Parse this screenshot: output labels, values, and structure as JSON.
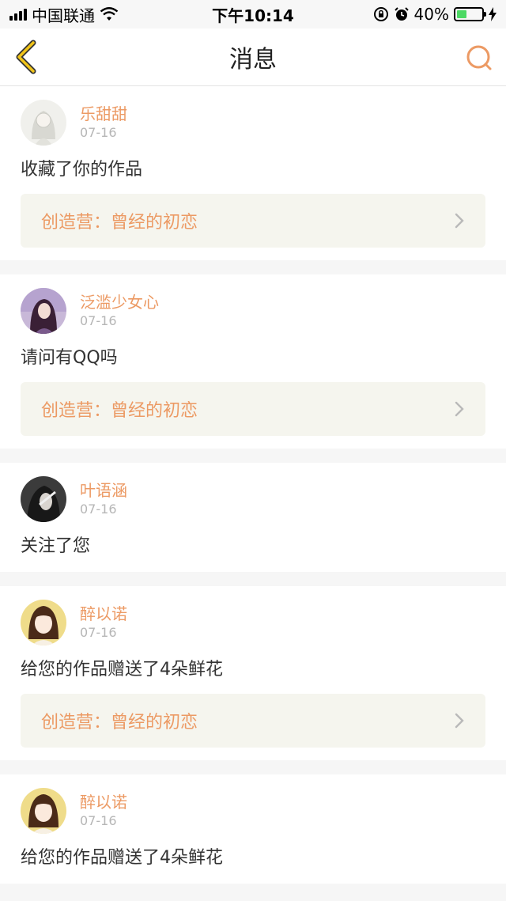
{
  "status": {
    "carrier": "中国联通",
    "time": "下午10:14",
    "battery": "40%",
    "battery_level": 0.4
  },
  "header": {
    "title": "消息"
  },
  "colors": {
    "accent": "#ec9a64",
    "back_icon": "#f0c419",
    "link_bg": "#f5f5ee"
  },
  "messages": [
    {
      "user": "乐甜甜",
      "date": "07-16",
      "text": "收藏了你的作品",
      "link": "创造营：曾经的初恋"
    },
    {
      "user": "泛滥少女心",
      "date": "07-16",
      "text": "请问有QQ吗",
      "link": "创造营：曾经的初恋"
    },
    {
      "user": "叶语涵",
      "date": "07-16",
      "text": "关注了您"
    },
    {
      "user": "醉以诺",
      "date": "07-16",
      "text": "给您的作品赠送了4朵鲜花",
      "link": "创造营：曾经的初恋"
    },
    {
      "user": "醉以诺",
      "date": "07-16",
      "text": "给您的作品赠送了4朵鲜花"
    }
  ]
}
